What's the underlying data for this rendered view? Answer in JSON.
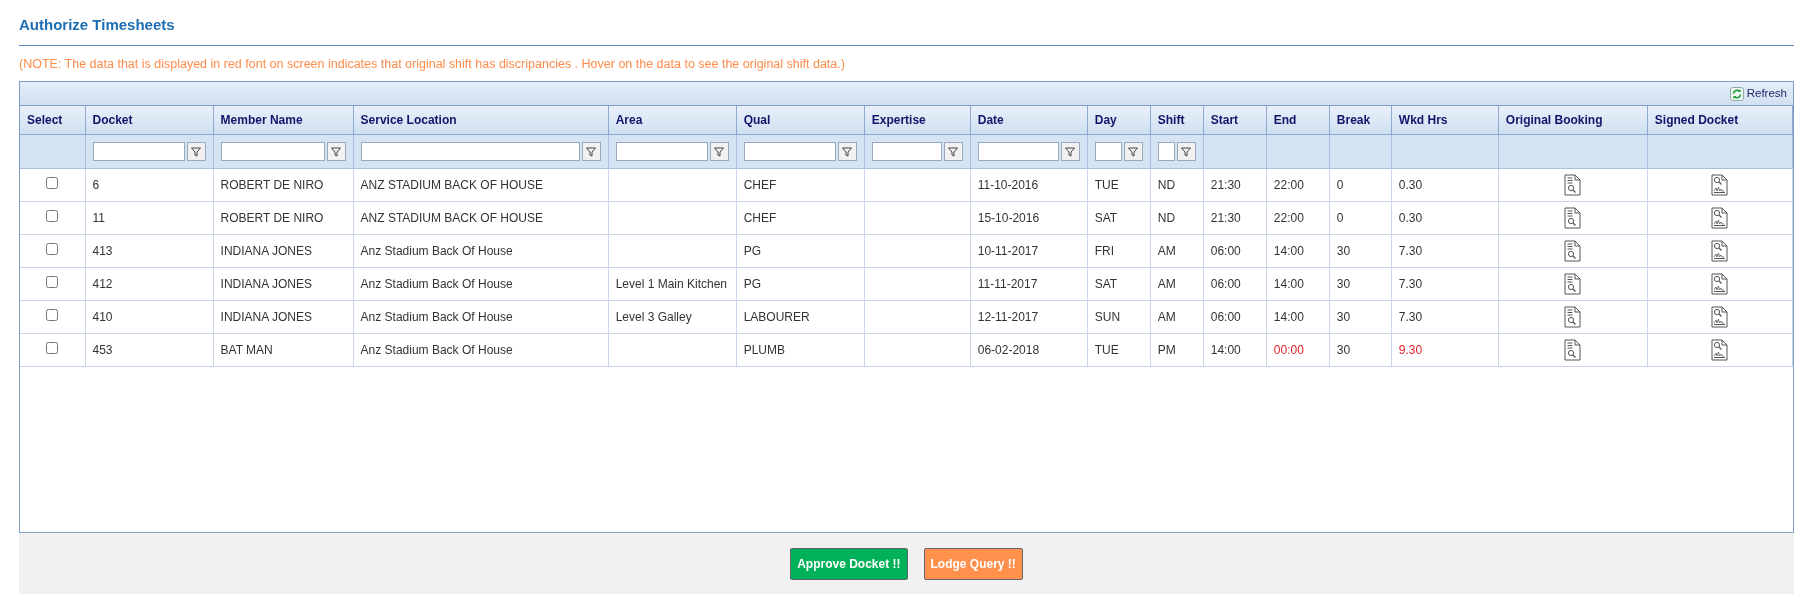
{
  "page_title": "Authorize Timesheets",
  "note": "(NOTE: The data that is displayed in red font on screen indicates that original shift has discripancies . Hover on the data to see the original shift data.)",
  "toolbar": {
    "refresh_label": "Refresh"
  },
  "columns": [
    {
      "label": "Select",
      "filter": false
    },
    {
      "label": "Docket",
      "filter": true
    },
    {
      "label": "Member Name",
      "filter": true
    },
    {
      "label": "Service Location",
      "filter": true
    },
    {
      "label": "Area",
      "filter": true
    },
    {
      "label": "Qual",
      "filter": true
    },
    {
      "label": "Expertise",
      "filter": true
    },
    {
      "label": "Date",
      "filter": true
    },
    {
      "label": "Day",
      "filter": true
    },
    {
      "label": "Shift",
      "filter": true
    },
    {
      "label": "Start",
      "filter": false
    },
    {
      "label": "End",
      "filter": false
    },
    {
      "label": "Break",
      "filter": false
    },
    {
      "label": "Wkd Hrs",
      "filter": false
    },
    {
      "label": "Original Booking",
      "filter": false
    },
    {
      "label": "Signed Docket",
      "filter": false
    }
  ],
  "rows": [
    {
      "checked": false,
      "docket": "6",
      "member_name": "ROBERT DE NIRO",
      "service_location": "ANZ STADIUM BACK OF HOUSE",
      "qual": "CHEF",
      "date": "11-10-2016",
      "day": "TUE",
      "shift": "ND",
      "start": "21:30",
      "end": "22:00",
      "break": "0",
      "wkd_hrs": "0.30",
      "end_discrepancy": false,
      "wkd_hrs_discrepancy": false
    },
    {
      "checked": false,
      "docket": "11",
      "member_name": "ROBERT DE NIRO",
      "service_location": "ANZ STADIUM BACK OF HOUSE",
      "qual": "CHEF",
      "date": "15-10-2016",
      "day": "SAT",
      "shift": "ND",
      "start": "21:30",
      "end": "22:00",
      "break": "0",
      "wkd_hrs": "0.30",
      "end_discrepancy": false,
      "wkd_hrs_discrepancy": false
    },
    {
      "checked": false,
      "docket": "413",
      "member_name": "INDIANA JONES",
      "service_location": "Anz Stadium Back Of House",
      "qual": "PG",
      "date": "10-11-2017",
      "day": "FRI",
      "shift": "AM",
      "start": "06:00",
      "end": "14:00",
      "break": "30",
      "wkd_hrs": "7.30",
      "end_discrepancy": false,
      "wkd_hrs_discrepancy": false
    },
    {
      "checked": false,
      "docket": "412",
      "member_name": "INDIANA JONES",
      "service_location": "Anz Stadium Back Of House",
      "area": "Level 1 Main Kitchen",
      "qual": "PG",
      "date": "11-11-2017",
      "day": "SAT",
      "shift": "AM",
      "start": "06:00",
      "end": "14:00",
      "break": "30",
      "wkd_hrs": "7.30",
      "end_discrepancy": false,
      "wkd_hrs_discrepancy": false
    },
    {
      "checked": false,
      "docket": "410",
      "member_name": "INDIANA JONES",
      "service_location": "Anz Stadium Back Of House",
      "area": "Level 3 Galley",
      "qual": "LABOURER",
      "date": "12-11-2017",
      "day": "SUN",
      "shift": "AM",
      "start": "06:00",
      "end": "14:00",
      "break": "30",
      "wkd_hrs": "7.30",
      "end_discrepancy": false,
      "wkd_hrs_discrepancy": false
    },
    {
      "checked": false,
      "docket": "453",
      "member_name": "BAT MAN",
      "service_location": "Anz Stadium Back Of House",
      "qual": "PLUMB",
      "date": "06-02-2018",
      "day": "TUE",
      "shift": "PM",
      "start": "14:00",
      "end": "00:00",
      "break": "30",
      "wkd_hrs": "9.30",
      "end_discrepancy": true,
      "wkd_hrs_discrepancy": true
    }
  ],
  "buttons": [
    {
      "kind": "approve",
      "label": "Approve Docket !!"
    },
    {
      "kind": "query",
      "label": "Lodge Query !!"
    }
  ]
}
